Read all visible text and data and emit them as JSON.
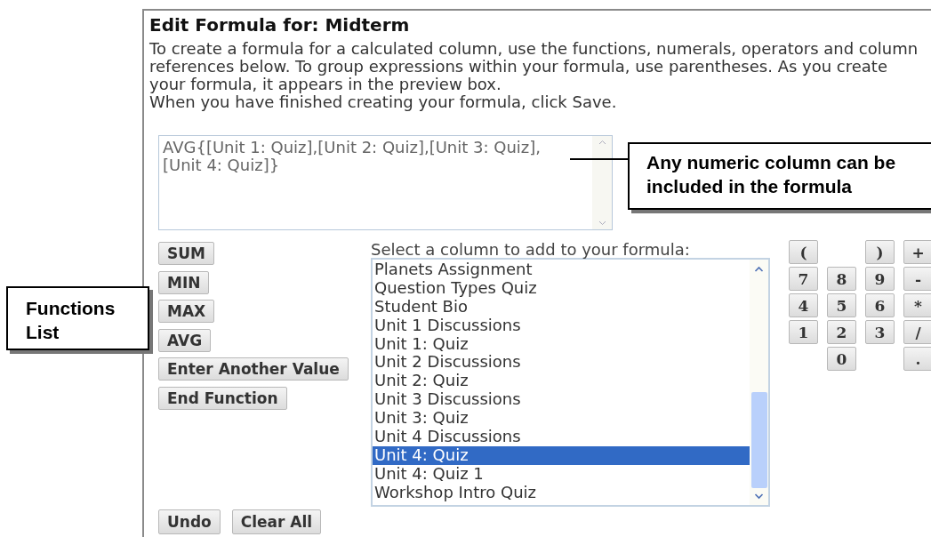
{
  "title": "Edit Formula for: Midterm",
  "instructions": [
    "To create a formula for a calculated column, use the functions, numerals, operators and column references below. To group expressions within your formula, use parentheses. As you create your formula, it appears in the preview box.",
    "When you have finished creating your formula, click Save."
  ],
  "preview": {
    "value": "AVG{[Unit 1: Quiz],[Unit 2: Quiz],[Unit 3: Quiz],\n[Unit 4: Quiz]}"
  },
  "functions": [
    "SUM",
    "MIN",
    "MAX",
    "AVG",
    "Enter Another Value",
    "End Function"
  ],
  "column_list": {
    "label": "Select a column to add to your formula:",
    "items": [
      {
        "label": "Planets Assignment",
        "selected": false
      },
      {
        "label": "Question Types Quiz",
        "selected": false
      },
      {
        "label": "Student Bio",
        "selected": false
      },
      {
        "label": "Unit 1 Discussions",
        "selected": false
      },
      {
        "label": "Unit 1: Quiz",
        "selected": false
      },
      {
        "label": "Unit 2 Discussions",
        "selected": false
      },
      {
        "label": "Unit 2: Quiz",
        "selected": false
      },
      {
        "label": "Unit 3 Discussions",
        "selected": false
      },
      {
        "label": "Unit 3: Quiz",
        "selected": false
      },
      {
        "label": "Unit 4 Discussions",
        "selected": false
      },
      {
        "label": "Unit 4: Quiz",
        "selected": true
      },
      {
        "label": "Unit 4: Quiz 1",
        "selected": false
      },
      {
        "label": "Workshop Intro Quiz",
        "selected": false
      }
    ]
  },
  "keypad": [
    {
      "kind": "key",
      "label": "("
    },
    {
      "kind": "blank"
    },
    {
      "kind": "key",
      "label": ")"
    },
    {
      "kind": "key",
      "label": "+"
    },
    {
      "kind": "key",
      "label": "7"
    },
    {
      "kind": "key",
      "label": "8"
    },
    {
      "kind": "key",
      "label": "9"
    },
    {
      "kind": "key",
      "label": "-"
    },
    {
      "kind": "key",
      "label": "4"
    },
    {
      "kind": "key",
      "label": "5"
    },
    {
      "kind": "key",
      "label": "6"
    },
    {
      "kind": "key",
      "label": "*"
    },
    {
      "kind": "key",
      "label": "1"
    },
    {
      "kind": "key",
      "label": "2"
    },
    {
      "kind": "key",
      "label": "3"
    },
    {
      "kind": "key",
      "label": "/"
    },
    {
      "kind": "blank"
    },
    {
      "kind": "key",
      "label": "0"
    },
    {
      "kind": "blank"
    },
    {
      "kind": "key",
      "label": "."
    }
  ],
  "actions": [
    "Undo",
    "Clear All"
  ],
  "callouts": [
    {
      "text": "Any numeric column can be included in the formula",
      "kind": "leader"
    },
    {
      "text": "Functions List",
      "kind": "plain"
    }
  ]
}
